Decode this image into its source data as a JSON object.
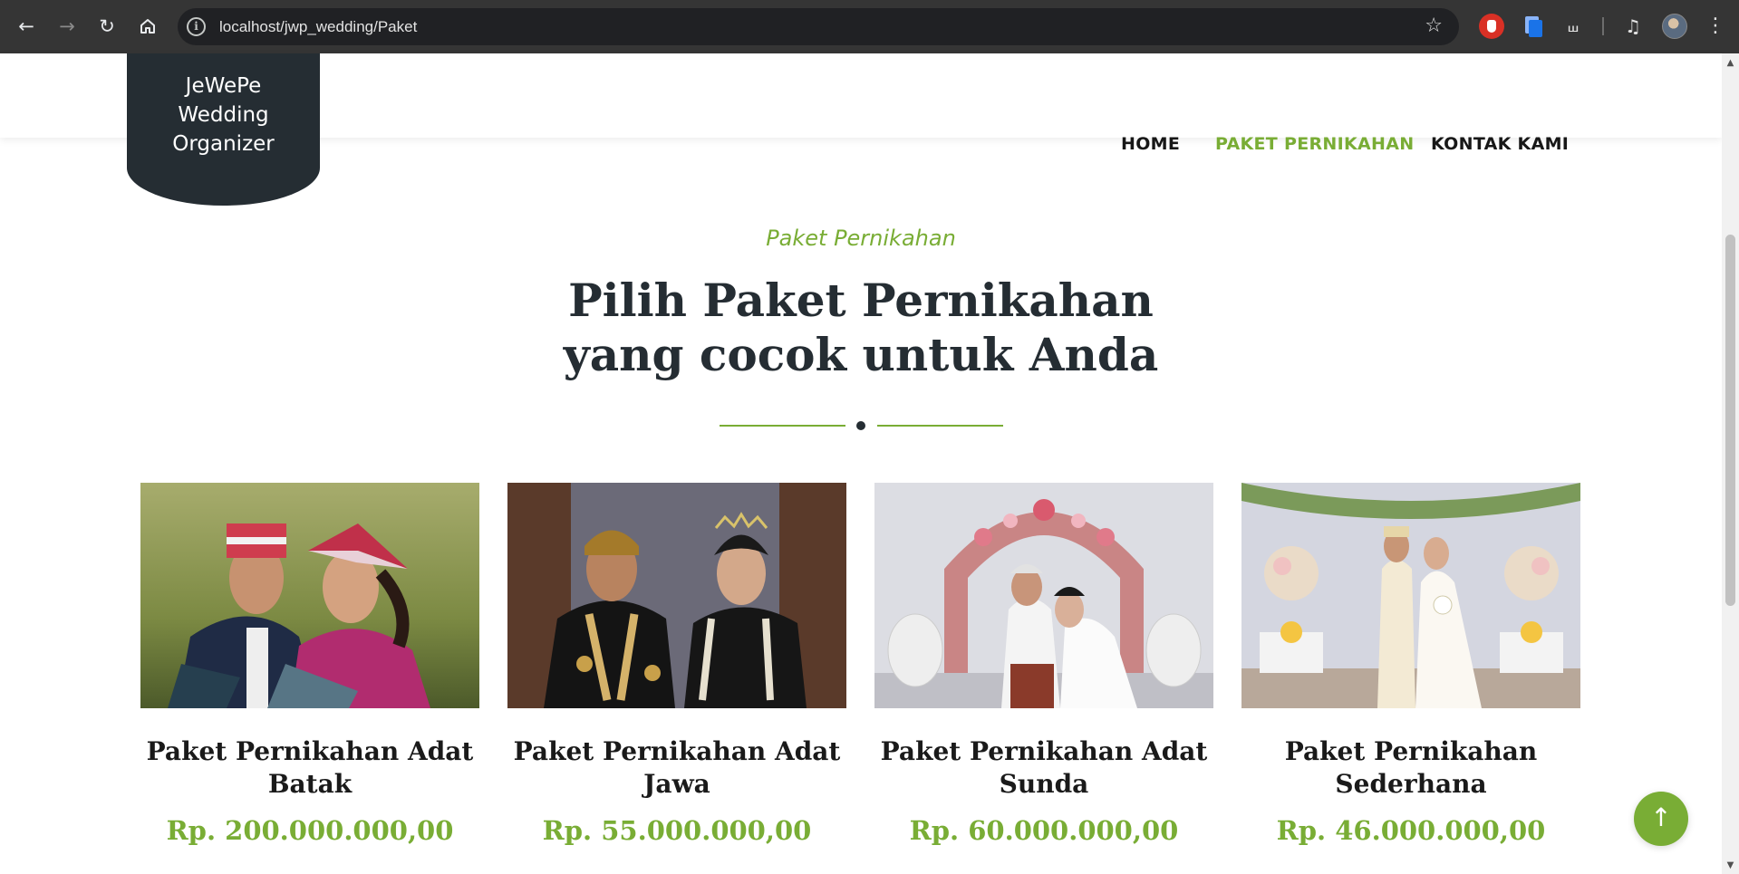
{
  "browser": {
    "url": "localhost/jwp_wedding/Paket",
    "back_icon": "arrow-left-icon",
    "forward_icon": "arrow-right-icon",
    "reload_icon": "reload-icon",
    "home_icon": "home-icon",
    "site_info_icon": "info-icon",
    "bookmark_icon": "star-icon",
    "menu_icon": "more-vertical-icon"
  },
  "site": {
    "logo_lines": [
      "JeWePe",
      "Wedding",
      "Organizer"
    ],
    "nav": [
      {
        "label": "HOME",
        "active": false
      },
      {
        "label": "PAKET PERNIKAHAN",
        "active": true
      },
      {
        "label": "KONTAK KAMI",
        "active": false
      }
    ]
  },
  "section": {
    "eyebrow": "Paket Pernikahan",
    "headline_lines": [
      "Pilih Paket Pernikahan",
      "yang cocok untuk Anda"
    ]
  },
  "packages": [
    {
      "title_lines": [
        "Paket Pernikahan Adat",
        "Batak"
      ],
      "price": "Rp. 200.000.000,00",
      "image": "batak-wedding-couple-photo"
    },
    {
      "title_lines": [
        "Paket Pernikahan Adat",
        "Jawa"
      ],
      "price": "Rp. 55.000.000,00",
      "image": "javanese-wedding-couple-photo"
    },
    {
      "title_lines": [
        "Paket Pernikahan Adat",
        "Sunda"
      ],
      "price": "Rp. 60.000.000,00",
      "image": "sundanese-wedding-ceremony-photo"
    },
    {
      "title_lines": [
        "Paket Pernikahan",
        "Sederhana"
      ],
      "price": "Rp. 46.000.000,00",
      "image": "simple-wedding-couple-photo"
    }
  ],
  "colors": {
    "accent": "#79ad35",
    "dark": "#252d33",
    "chrome": "#353535"
  },
  "scroll_to_top_icon": "arrow-up-icon"
}
